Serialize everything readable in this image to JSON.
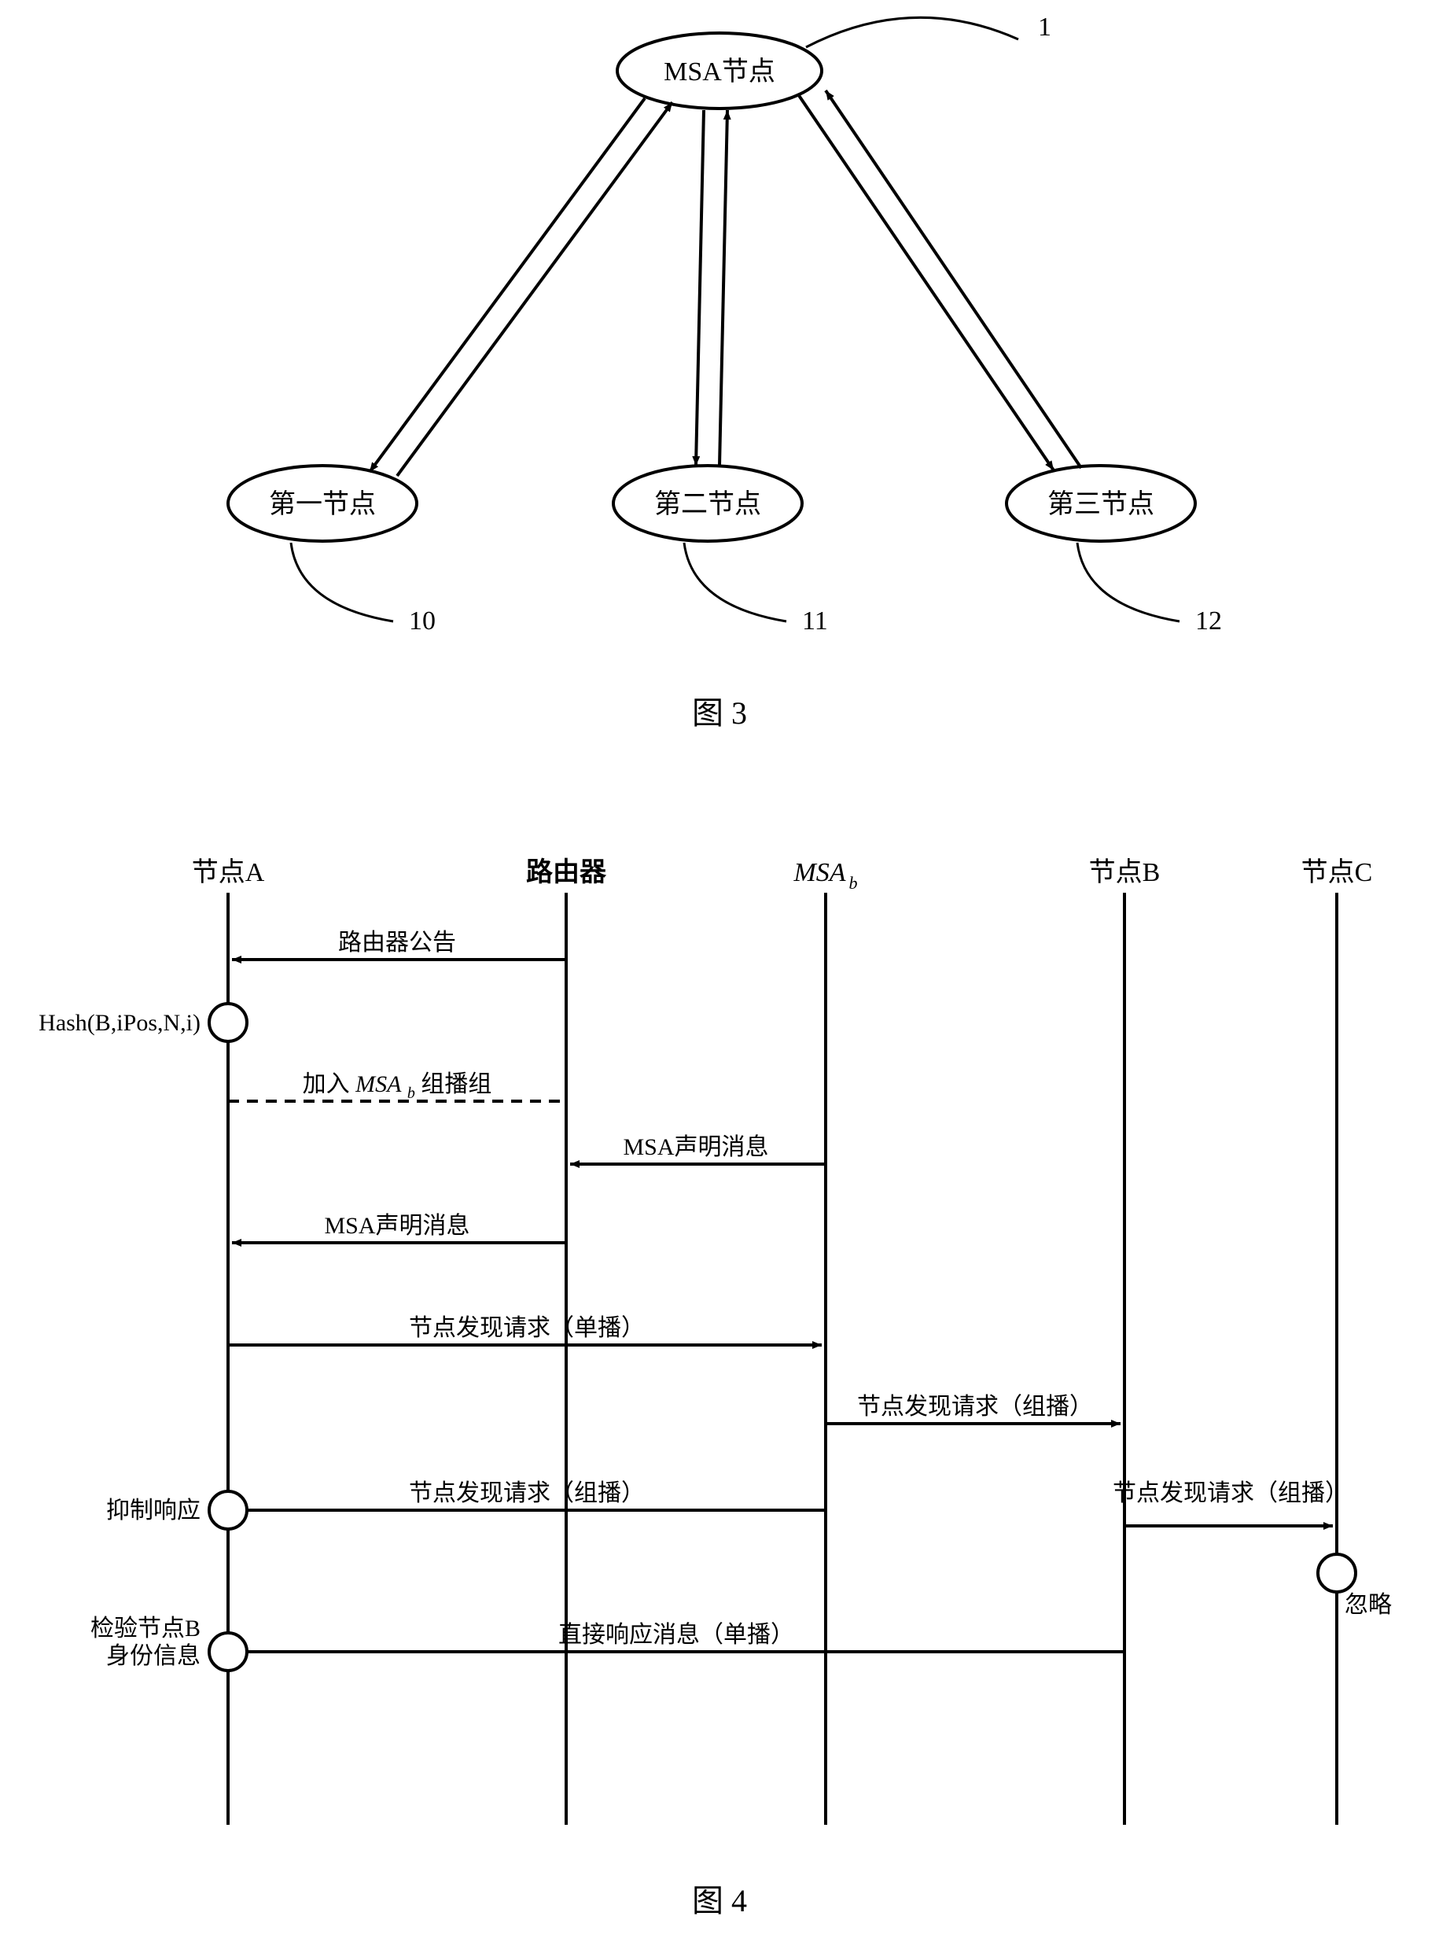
{
  "figure3": {
    "caption": "图 3",
    "nodes": {
      "top": {
        "label": "MSA节点",
        "ref": "1"
      },
      "left": {
        "label": "第一节点",
        "ref": "10"
      },
      "mid": {
        "label": "第二节点",
        "ref": "11"
      },
      "right": {
        "label": "第三节点",
        "ref": "12"
      }
    }
  },
  "figure4": {
    "caption": "图 4",
    "lifelines": {
      "a": "节点A",
      "router": "路由器",
      "msa": "MSA",
      "msa_sub": "b",
      "b": "节点B",
      "c": "节点C"
    },
    "messages": {
      "m1": "路由器公告",
      "hash": "Hash(B,iPos,N,i)",
      "join_prefix": "加入",
      "join_msa": "MSA",
      "join_sub": "b",
      "join_suffix": "组播组",
      "m2": "MSA声明消息",
      "m3": "MSA声明消息",
      "m4": "节点发现请求（单播）",
      "m5": "节点发现请求（组播）",
      "m6": "节点发现请求（组播）",
      "m7": "节点发现请求（组播）",
      "suppress": "抑制响应",
      "ignore": "忽略",
      "m8": "直接响应消息（单播）",
      "verify_l1": "检验节点B",
      "verify_l2": "身份信息"
    }
  }
}
